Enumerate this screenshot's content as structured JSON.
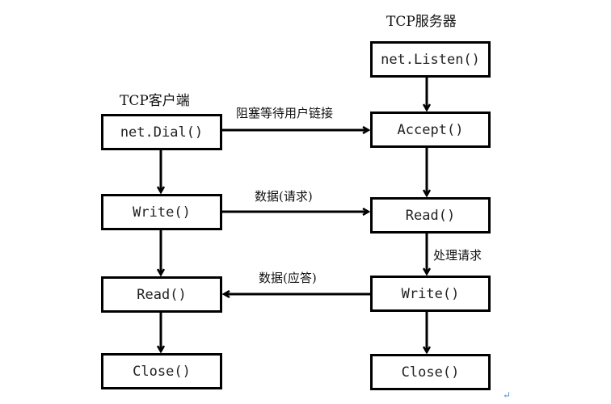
{
  "client": {
    "title": "TCP客户端",
    "steps": [
      "net.Dial()",
      "Write()",
      "Read()",
      "Close()"
    ]
  },
  "server": {
    "title": "TCP服务器",
    "steps": [
      "net.Listen()",
      "Accept()",
      "Read()",
      "Write()",
      "Close()"
    ]
  },
  "edges": {
    "connect": "阻塞等待用户链接",
    "request": "数据(请求)",
    "process": "处理请求",
    "response": "数据(应答)"
  },
  "paragraph_mark": "↵",
  "colors": {
    "stroke": "#000000",
    "mark": "#4a90d9"
  }
}
